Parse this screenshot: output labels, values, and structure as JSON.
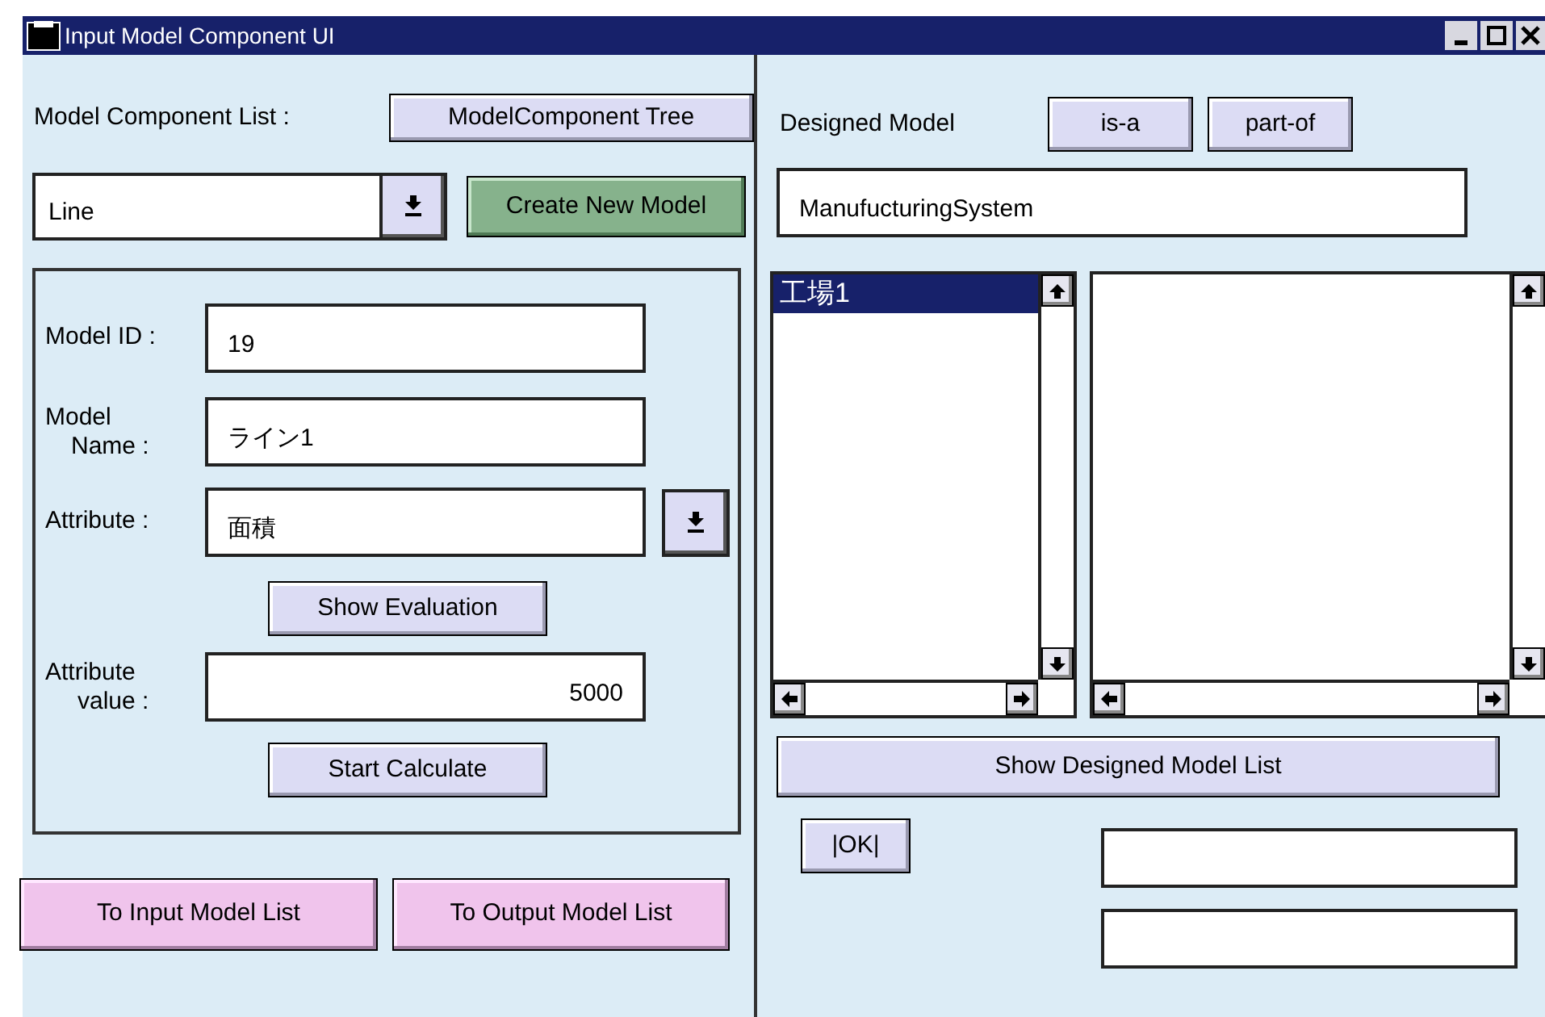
{
  "window": {
    "title": "Input Model Component UI"
  },
  "left": {
    "component_list_label": "Model Component List :",
    "tree_button": "ModelComponent Tree",
    "combo_value": "Line",
    "create_button": "Create New Model",
    "form": {
      "model_id_label": "Model ID :",
      "model_id": "19",
      "model_name_label_1": "Model",
      "model_name_label_2": "Name :",
      "model_name": "ライン1",
      "attribute_label": "Attribute :",
      "attribute": "面積",
      "show_evaluation_button": "Show Evaluation",
      "attribute_value_label_1": "Attribute",
      "attribute_value_label_2": "value :",
      "attribute_value": "5000",
      "start_button": "Start Calculate"
    },
    "bottom_buttons": [
      "To Input Model List",
      "To Output Model List"
    ]
  },
  "right": {
    "designed_model_label": "Designed Model",
    "relation_buttons": [
      "is-a",
      "part-of"
    ],
    "designed_model_value": "ManufucturingSystem",
    "list_items": [
      {
        "label": "工場1",
        "selected": true
      }
    ],
    "show_list_button": "Show Designed Model List",
    "ok_button": "|OK|"
  }
}
